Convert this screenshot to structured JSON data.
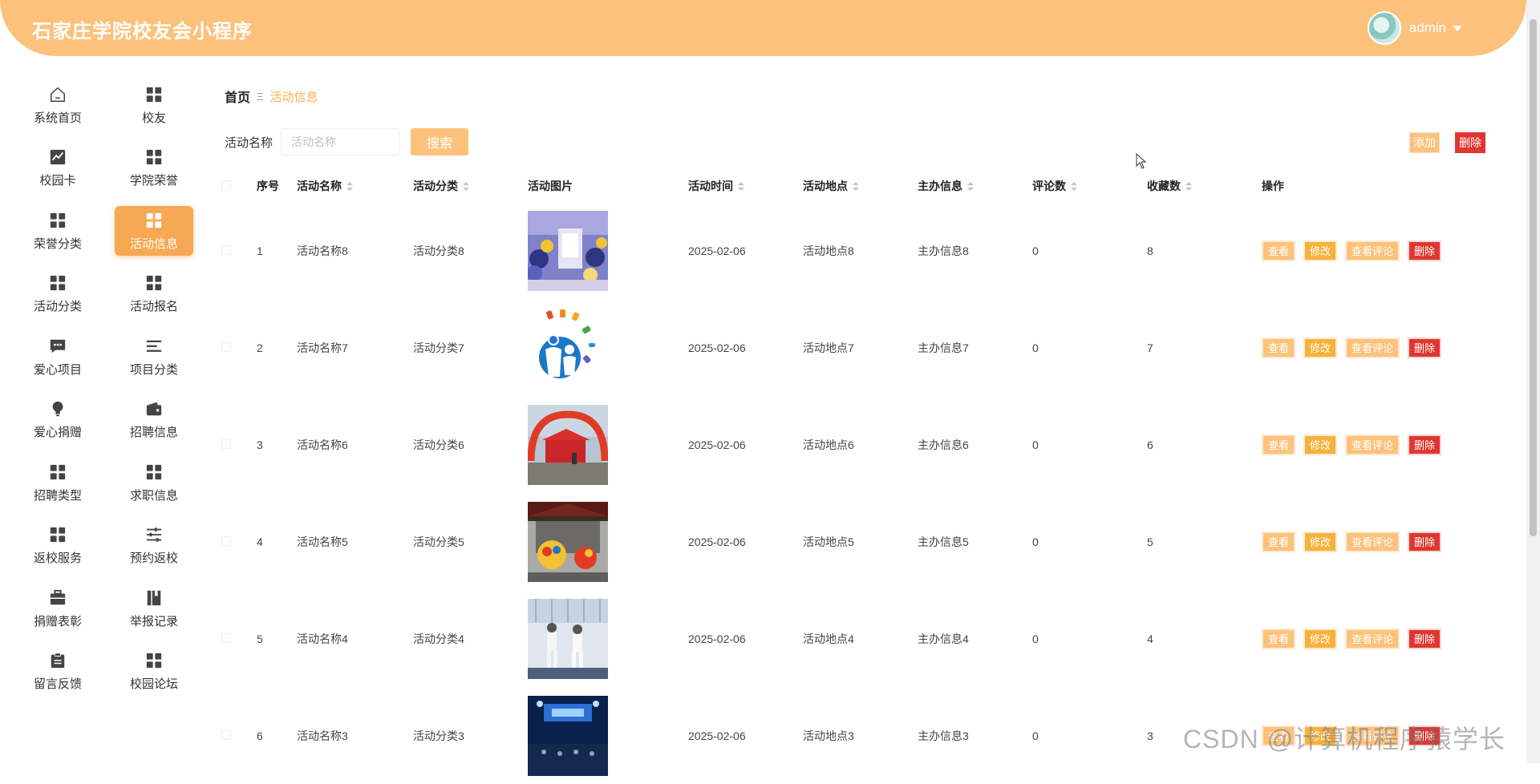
{
  "header": {
    "title": "石家庄学院校友会小程序",
    "username": "admin"
  },
  "sidebar": {
    "items": [
      {
        "label": "系统首页",
        "icon": "home-icon"
      },
      {
        "label": "校友",
        "icon": "grid-icon"
      },
      {
        "label": "校园卡",
        "icon": "chart-icon"
      },
      {
        "label": "学院荣誉",
        "icon": "grid-icon"
      },
      {
        "label": "荣誉分类",
        "icon": "grid-icon"
      },
      {
        "label": "活动信息",
        "icon": "grid-icon",
        "active": true
      },
      {
        "label": "活动分类",
        "icon": "grid-icon"
      },
      {
        "label": "活动报名",
        "icon": "grid-icon"
      },
      {
        "label": "爱心项目",
        "icon": "message-icon"
      },
      {
        "label": "项目分类",
        "icon": "list-icon"
      },
      {
        "label": "爱心捐赠",
        "icon": "bulb-icon"
      },
      {
        "label": "招聘信息",
        "icon": "wallet-icon"
      },
      {
        "label": "招聘类型",
        "icon": "grid-icon"
      },
      {
        "label": "求职信息",
        "icon": "grid-icon"
      },
      {
        "label": "返校服务",
        "icon": "grid-icon"
      },
      {
        "label": "预约返校",
        "icon": "sliders-icon"
      },
      {
        "label": "捐赠表彰",
        "icon": "briefcase-icon"
      },
      {
        "label": "举报记录",
        "icon": "book-icon"
      },
      {
        "label": "留言反馈",
        "icon": "clipboard-icon"
      },
      {
        "label": "校园论坛",
        "icon": "grid-icon"
      }
    ]
  },
  "breadcrumb": {
    "home": "首页",
    "separator": "Ξ",
    "current": "活动信息"
  },
  "search": {
    "label": "活动名称",
    "placeholder": "活动名称",
    "button": "搜索"
  },
  "actions": {
    "add": "添加",
    "delete": "删除"
  },
  "table": {
    "headers": {
      "index": "序号",
      "name": "活动名称",
      "category": "活动分类",
      "image": "活动图片",
      "time": "活动时间",
      "place": "活动地点",
      "organizer": "主办信息",
      "comments": "评论数",
      "favorites": "收藏数",
      "ops": "操作"
    },
    "rows": [
      {
        "index": "1",
        "name": "活动名称8",
        "category": "活动分类8",
        "image": "venue-decor",
        "time": "2025-02-06",
        "place": "活动地点8",
        "organizer": "主办信息8",
        "comments": "0",
        "favorites": "8"
      },
      {
        "index": "2",
        "name": "活动名称7",
        "category": "活动分类7",
        "image": "logo-people",
        "time": "2025-02-06",
        "place": "活动地点7",
        "organizer": "主办信息7",
        "comments": "0",
        "favorites": "7"
      },
      {
        "index": "3",
        "name": "活动名称6",
        "category": "活动分类6",
        "image": "red-arch",
        "time": "2025-02-06",
        "place": "活动地点6",
        "organizer": "主办信息6",
        "comments": "0",
        "favorites": "6"
      },
      {
        "index": "4",
        "name": "活动名称5",
        "category": "活动分类5",
        "image": "lion-dance",
        "time": "2025-02-06",
        "place": "活动地点5",
        "organizer": "主办信息5",
        "comments": "0",
        "favorites": "5"
      },
      {
        "index": "5",
        "name": "活动名称4",
        "category": "活动分类4",
        "image": "fencing",
        "time": "2025-02-06",
        "place": "活动地点4",
        "organizer": "主办信息4",
        "comments": "0",
        "favorites": "4"
      },
      {
        "index": "6",
        "name": "活动名称3",
        "category": "活动分类3",
        "image": "stage-blue",
        "time": "2025-02-06",
        "place": "活动地点3",
        "organizer": "主办信息3",
        "comments": "0",
        "favorites": "3"
      }
    ],
    "op_labels": {
      "view": "查看",
      "edit": "修改",
      "comments": "查看评论",
      "delete": "删除"
    }
  },
  "watermark": "CSDN @计算机程序猿学长",
  "colors": {
    "brand": "#fcc27c",
    "active": "#f6a852",
    "danger": "#e0362f"
  }
}
